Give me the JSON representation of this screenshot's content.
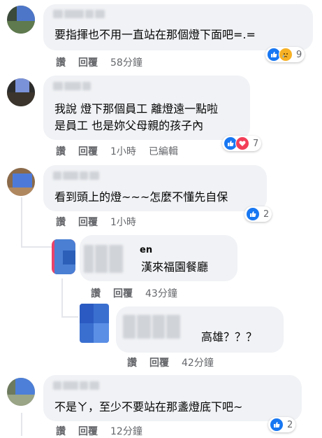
{
  "comments": [
    {
      "text": [
        "要指揮也不用一直站在那個燈下面吧=.="
      ],
      "actions": [
        "讚",
        "回覆"
      ],
      "time": "58分鐘",
      "edited": "",
      "reaction_count": "9",
      "reactions": [
        "like",
        "sad"
      ]
    },
    {
      "text": [
        "我說 燈下那個員工 離燈遠一點啦",
        "是員工 也是妳父母親的孩子內"
      ],
      "actions": [
        "讚",
        "回覆"
      ],
      "time": "1小時",
      "edited": "已編輯",
      "reaction_count": "7",
      "reactions": [
        "like",
        "love"
      ]
    },
    {
      "text": [
        "看到頭上的燈~~~怎麼不懂先自保"
      ],
      "actions": [
        "讚",
        "回覆"
      ],
      "time": "1小時",
      "edited": "",
      "reaction_count": "2",
      "reactions": [
        "like"
      ]
    },
    {
      "name_fragment": "en",
      "text": [
        "漢來福園餐廳"
      ],
      "actions": [
        "讚",
        "回覆"
      ],
      "time": "43分鐘",
      "edited": "",
      "reaction_count": "",
      "reactions": []
    },
    {
      "text": [
        "高雄？？？"
      ],
      "actions": [
        "讚",
        "回覆"
      ],
      "time": "42分鐘",
      "edited": "",
      "reaction_count": "",
      "reactions": []
    },
    {
      "text": [
        "不是ㄚ，至少不要站在那盞燈底下吧~"
      ],
      "actions": [
        "讚",
        "回覆"
      ],
      "time": "12分鐘",
      "edited": "",
      "reaction_count": "2",
      "reactions": [
        "like"
      ]
    }
  ],
  "colors": {
    "bubble": "#f0f2f5",
    "secondary_text": "#65676b",
    "like": "#1877f2",
    "love": "#f33e58",
    "sad": "#f7b125"
  },
  "icons": [
    "like-icon",
    "love-icon",
    "sad-icon"
  ]
}
